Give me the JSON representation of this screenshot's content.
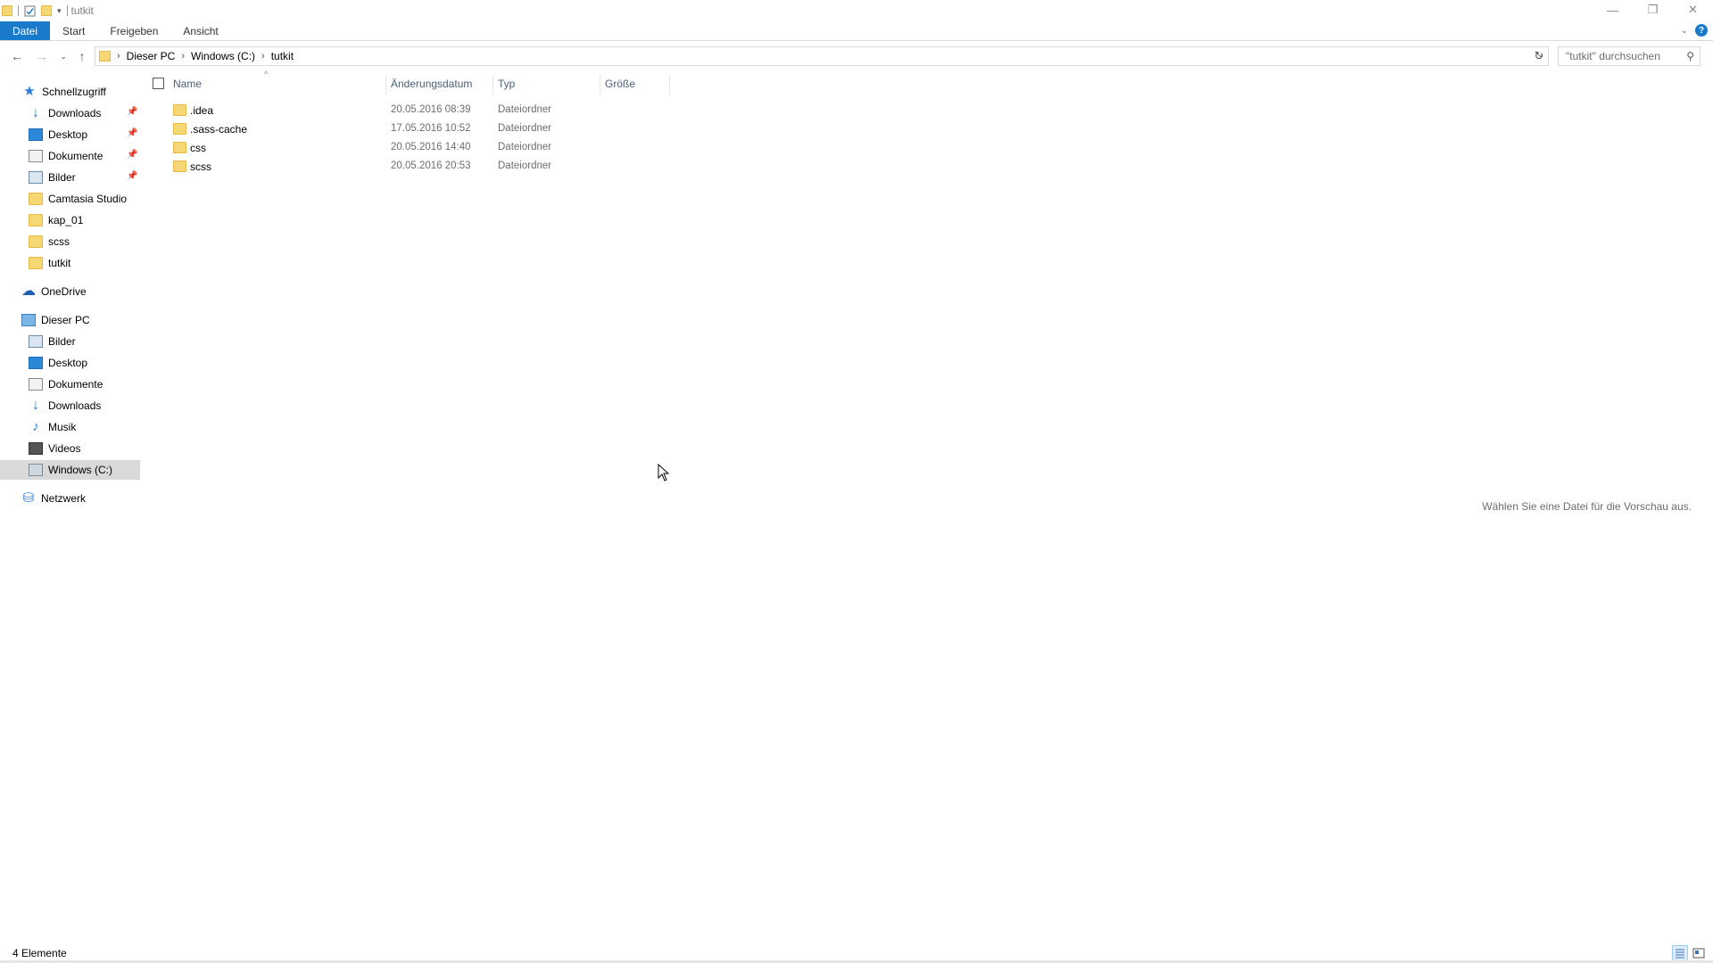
{
  "window": {
    "title": "tutkit",
    "controls": {
      "minimize_icon": "minimize-icon",
      "maximize_icon": "restore-icon",
      "close_icon": "close-icon"
    }
  },
  "ribbon": {
    "tabs": [
      {
        "label": "Datei",
        "active": true
      },
      {
        "label": "Start"
      },
      {
        "label": "Freigeben"
      },
      {
        "label": "Ansicht"
      }
    ],
    "help_label": "?"
  },
  "address": {
    "breadcrumbs": [
      "Dieser PC",
      "Windows (C:)",
      "tutkit"
    ],
    "search_placeholder": "\"tutkit\" durchsuchen"
  },
  "navigation": {
    "quick_access_label": "Schnellzugriff",
    "quick_items": [
      {
        "label": "Downloads",
        "icon": "download-icon",
        "pinned": true
      },
      {
        "label": "Desktop",
        "icon": "desktop-icon",
        "pinned": true
      },
      {
        "label": "Dokumente",
        "icon": "documents-icon",
        "pinned": true
      },
      {
        "label": "Bilder",
        "icon": "pictures-icon",
        "pinned": true
      },
      {
        "label": "Camtasia Studio",
        "icon": "folder-icon"
      },
      {
        "label": "kap_01",
        "icon": "folder-icon"
      },
      {
        "label": "scss",
        "icon": "folder-icon"
      },
      {
        "label": "tutkit",
        "icon": "folder-icon"
      }
    ],
    "onedrive_label": "OneDrive",
    "this_pc_label": "Dieser PC",
    "pc_items": [
      {
        "label": "Bilder",
        "icon": "pictures-icon"
      },
      {
        "label": "Desktop",
        "icon": "desktop-icon"
      },
      {
        "label": "Dokumente",
        "icon": "documents-icon"
      },
      {
        "label": "Downloads",
        "icon": "download-icon"
      },
      {
        "label": "Musik",
        "icon": "music-icon"
      },
      {
        "label": "Videos",
        "icon": "videos-icon"
      },
      {
        "label": "Windows (C:)",
        "icon": "drive-icon",
        "selected": true
      }
    ],
    "network_label": "Netzwerk"
  },
  "columns": {
    "name": "Name",
    "date": "Änderungsdatum",
    "type": "Typ",
    "size": "Größe"
  },
  "files": [
    {
      "name": ".idea",
      "date": "20.05.2016 08:39",
      "type": "Dateiordner"
    },
    {
      "name": ".sass-cache",
      "date": "17.05.2016 10:52",
      "type": "Dateiordner"
    },
    {
      "name": "css",
      "date": "20.05.2016 14:40",
      "type": "Dateiordner"
    },
    {
      "name": "scss",
      "date": "20.05.2016 20:53",
      "type": "Dateiordner"
    }
  ],
  "preview_text": "Wählen Sie eine Datei für die Vorschau aus.",
  "status": {
    "item_count": "4 Elemente"
  },
  "colors": {
    "accent": "#1979ca",
    "folder": "#f7d774",
    "selection": "#d9d9d9"
  }
}
